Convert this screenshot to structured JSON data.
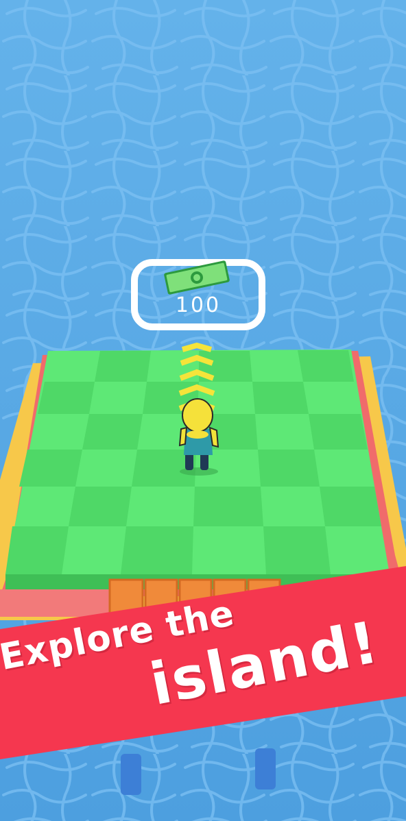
{
  "purchase_pad": {
    "price": "100",
    "icon": "cash-bill-icon"
  },
  "banner": {
    "line1": "Explore the",
    "line2": "island!"
  },
  "colors": {
    "water": "#5aa8e4",
    "grass_light": "#5ee876",
    "grass_dark": "#4fd867",
    "banner_red": "#f5374f",
    "platform_yellow": "#f7c84a",
    "arrow_yellow": "#f5e43a",
    "plank_orange": "#f08a3a"
  }
}
